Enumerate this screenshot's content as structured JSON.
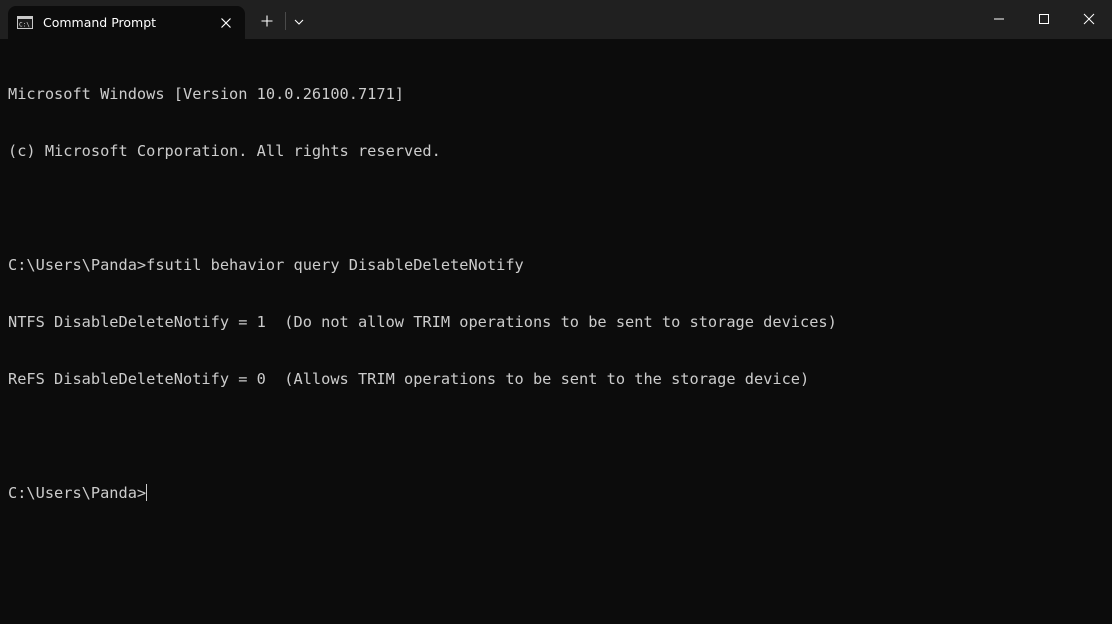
{
  "window": {
    "tab_title": "Command Prompt",
    "icons": {
      "tab": "cmd-icon",
      "tab_close": "close-icon",
      "new_tab": "plus-icon",
      "dropdown": "chevron-down-icon",
      "minimize": "minimize-icon",
      "maximize": "maximize-icon",
      "close": "close-icon"
    },
    "colors": {
      "titlebar": "#202020",
      "console_bg": "#0c0c0c",
      "console_text": "#cccccc"
    }
  },
  "console": {
    "lines": [
      "Microsoft Windows [Version 10.0.26100.7171]",
      "(c) Microsoft Corporation. All rights reserved.",
      "",
      "C:\\Users\\Panda>fsutil behavior query DisableDeleteNotify",
      "NTFS DisableDeleteNotify = 1  (Do not allow TRIM operations to be sent to storage devices)",
      "ReFS DisableDeleteNotify = 0  (Allows TRIM operations to be sent to the storage device)",
      ""
    ],
    "prompt": "C:\\Users\\Panda>",
    "input": ""
  }
}
